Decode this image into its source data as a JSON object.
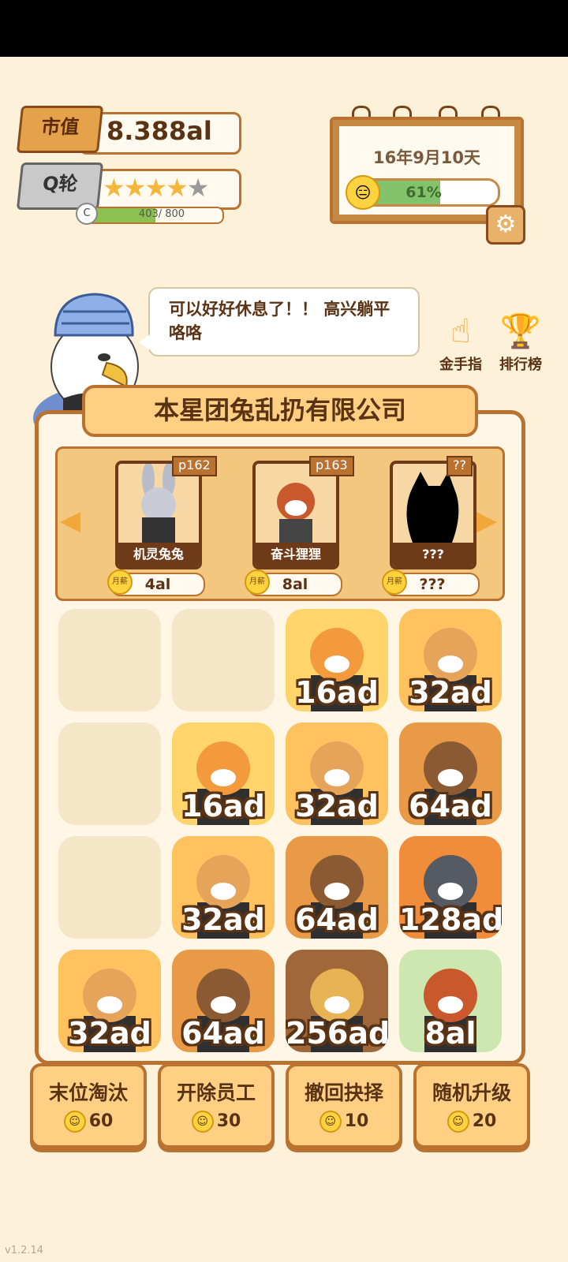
{
  "status": {
    "market_value_label": "市值",
    "market_value": "8.388al",
    "round_label": "Q轮",
    "stars_filled": 4,
    "stars_total": 5,
    "xp_badge": "C",
    "xp_text": "403/ 800",
    "xp_progress": 0.50375
  },
  "calendar": {
    "date": "16年9月10天",
    "mood_text": "61%",
    "mood_progress": 0.61,
    "settings_icon": "gear-icon"
  },
  "dialog": {
    "text": "可以好好休息了！！ 高兴躺平咯咯"
  },
  "side_buttons": [
    {
      "label": "金手指",
      "icon": "pointing-hand-icon"
    },
    {
      "label": "排行榜",
      "icon": "trophy-icon"
    }
  ],
  "company": {
    "name": "本星团兔乱扔有限公司"
  },
  "carousel": {
    "salary_label": "月薪",
    "cards": [
      {
        "tag": "p162",
        "name": "机灵兔兔",
        "salary": "4al"
      },
      {
        "tag": "p163",
        "name": "奋斗狸狸",
        "salary": "8al"
      },
      {
        "tag": "??",
        "name": "???",
        "salary": "???"
      }
    ]
  },
  "grid": [
    [
      "",
      "",
      "16ad",
      "32ad"
    ],
    [
      "",
      "16ad",
      "32ad",
      "64ad"
    ],
    [
      "",
      "32ad",
      "64ad",
      "128ad"
    ],
    [
      "32ad",
      "64ad",
      "256ad",
      "8al"
    ]
  ],
  "actions": [
    {
      "label": "末位淘汰",
      "cost": "60"
    },
    {
      "label": "开除员工",
      "cost": "30"
    },
    {
      "label": "撤回抉择",
      "cost": "10"
    },
    {
      "label": "随机升级",
      "cost": "20"
    }
  ],
  "version": "v1.2.14",
  "colors": {
    "background": "#fdf1da",
    "accent": "#b9722f",
    "mood_fill": "#82c26b",
    "xp_fill": "#8cc152"
  }
}
